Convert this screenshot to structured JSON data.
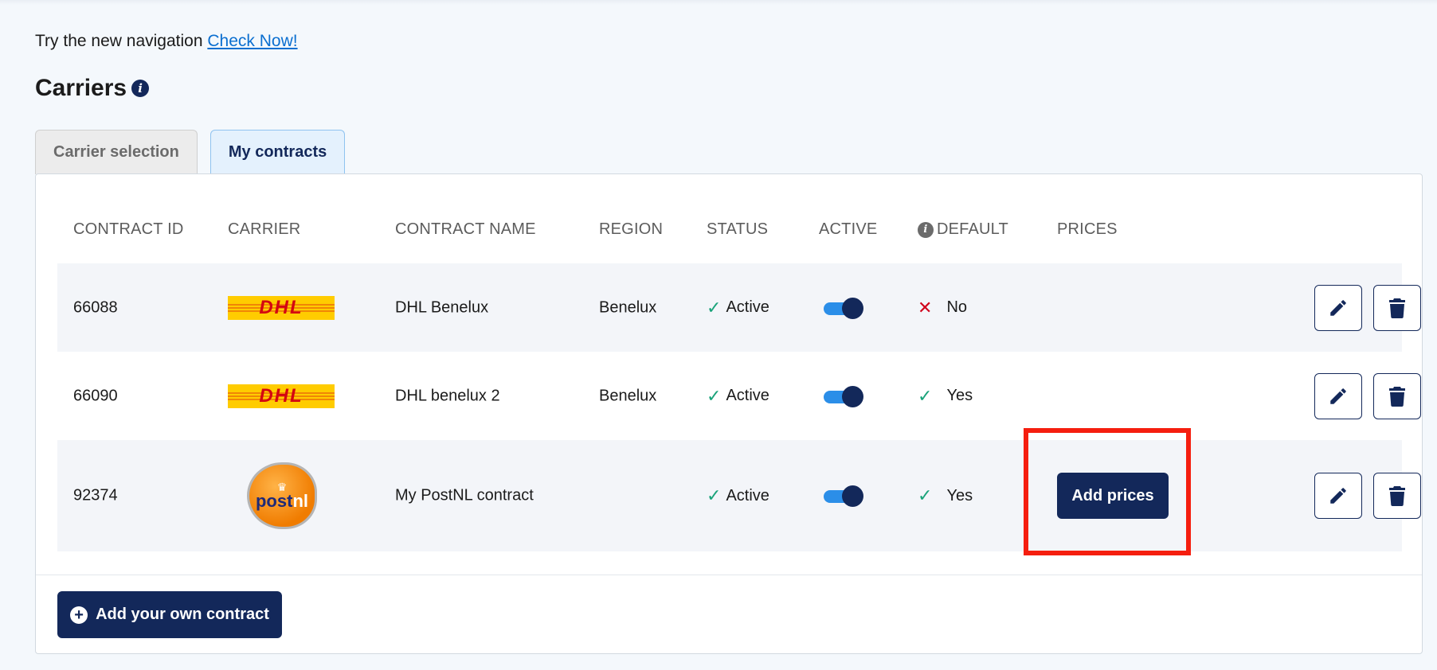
{
  "nav_note": {
    "text": "Try the new navigation",
    "link": "Check Now!"
  },
  "page": {
    "title": "Carriers",
    "info_icon": "info-icon"
  },
  "tabs": [
    {
      "label": "Carrier selection",
      "active": false
    },
    {
      "label": "My contracts",
      "active": true
    }
  ],
  "table": {
    "headers": {
      "contract_id": "CONTRACT ID",
      "carrier": "CARRIER",
      "contract_name": "CONTRACT NAME",
      "region": "REGION",
      "status": "STATUS",
      "active": "ACTIVE",
      "default": "DEFAULT",
      "prices": "PRICES"
    },
    "rows": [
      {
        "contract_id": "66088",
        "carrier_logo": "DHL",
        "contract_name": "DHL Benelux",
        "region": "Benelux",
        "status": "Active",
        "active": true,
        "default": "No",
        "default_icon": "cross-icon",
        "prices": ""
      },
      {
        "contract_id": "66090",
        "carrier_logo": "DHL",
        "contract_name": "DHL benelux 2",
        "region": "Benelux",
        "status": "Active",
        "active": true,
        "default": "Yes",
        "default_icon": "check-icon",
        "prices": ""
      },
      {
        "contract_id": "92374",
        "carrier_logo": "postnl",
        "contract_name": "My PostNL contract",
        "region": "",
        "status": "Active",
        "active": true,
        "default": "Yes",
        "default_icon": "check-icon",
        "prices": "Add prices"
      }
    ]
  },
  "footer": {
    "add_contract_label": "Add your own contract"
  },
  "colors": {
    "primary": "#13285a",
    "toggle_track": "#2b8ee8",
    "success": "#1aa37a",
    "error": "#d0021b",
    "link": "#0b6fd0",
    "highlight": "#f51e0f",
    "dhl_yellow": "#ffcc00",
    "dhl_red": "#d40511",
    "postnl_orange": "#f07c00"
  }
}
